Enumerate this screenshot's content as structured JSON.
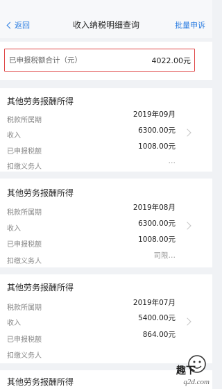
{
  "navbar": {
    "back_label": "返回",
    "title": "收入纳税明细查询",
    "action_label": "批量申诉"
  },
  "summary": {
    "label": "已申报税额合计（元）",
    "value": "4022.00元"
  },
  "cards": [
    {
      "title": "其他劳务报酬所得",
      "rows": [
        {
          "label": "税款所属期",
          "value": "2019年09月"
        },
        {
          "label": "收入",
          "value": "6300.00元"
        },
        {
          "label": "已申报税额",
          "value": "1008.00元"
        },
        {
          "label": "扣缴义务人",
          "value": "…"
        }
      ]
    },
    {
      "title": "其他劳务报酬所得",
      "rows": [
        {
          "label": "税款所属期",
          "value": "2019年08月"
        },
        {
          "label": "收入",
          "value": "6300.00元"
        },
        {
          "label": "已申报税额",
          "value": "1008.00元"
        },
        {
          "label": "扣缴义务人",
          "value": "司限…"
        }
      ]
    },
    {
      "title": "其他劳务报酬所得",
      "rows": [
        {
          "label": "税款所属期",
          "value": "2019年07月"
        },
        {
          "label": "收入",
          "value": "5400.00元"
        },
        {
          "label": "已申报税额",
          "value": "864.00元"
        },
        {
          "label": "扣缴义务人",
          "value": ""
        }
      ]
    },
    {
      "title": "其他劳务报酬所得",
      "rows": []
    }
  ],
  "watermark": {
    "text": "q2d.com",
    "brand": "趣下",
    "icon": "smiley-logo-icon"
  }
}
